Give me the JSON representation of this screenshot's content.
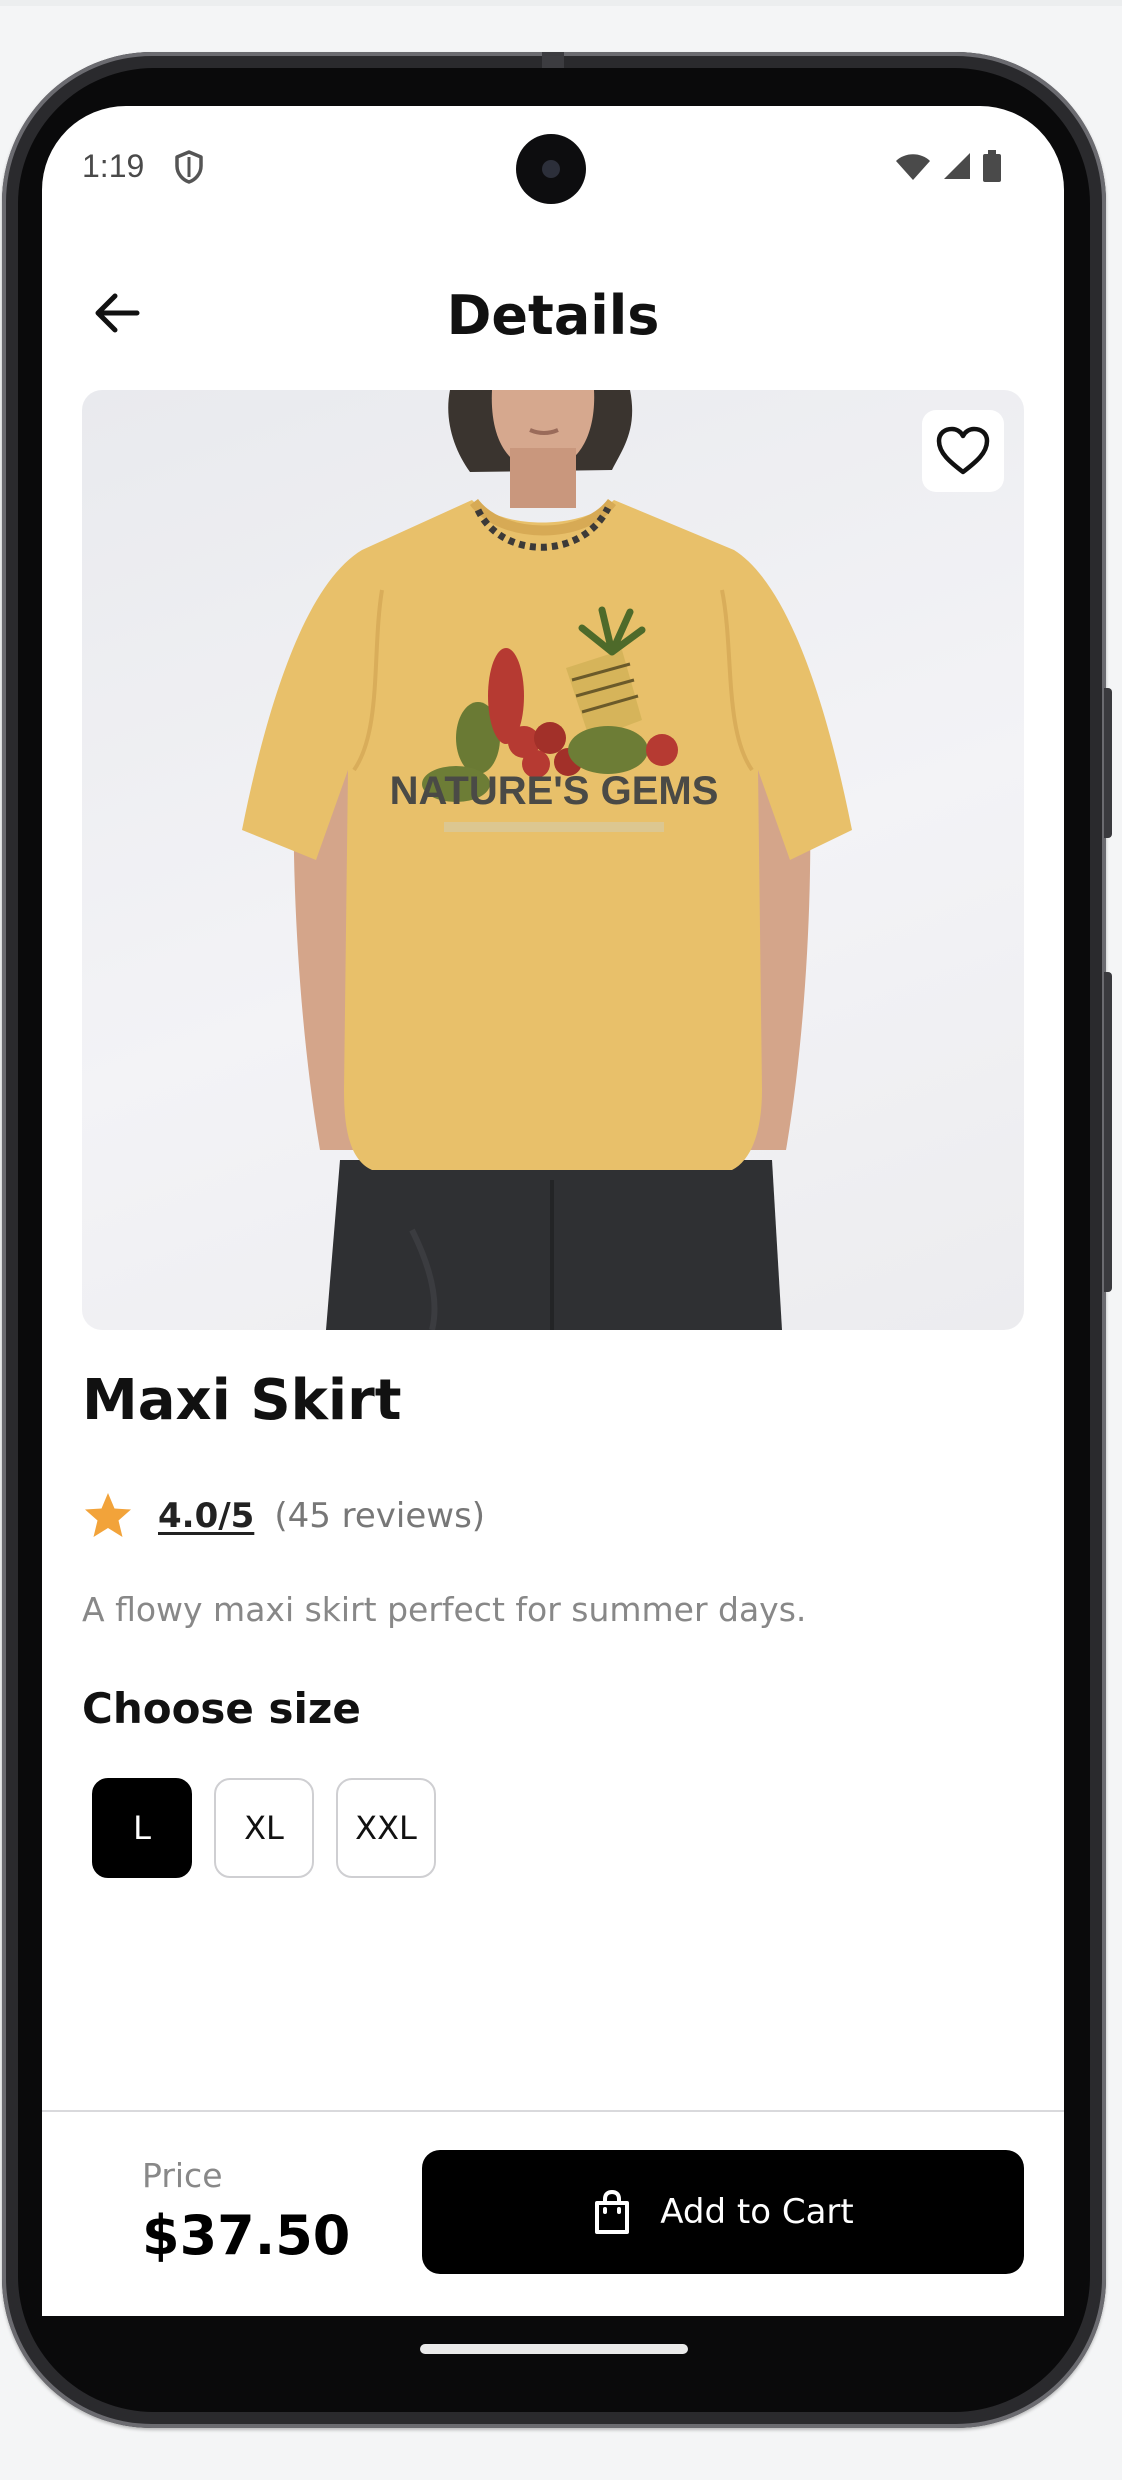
{
  "status_bar": {
    "time": "1:19",
    "left_icons": [
      "shield-icon"
    ],
    "right_icons": [
      "wifi-icon",
      "signal-icon",
      "battery-icon"
    ]
  },
  "header": {
    "title": "Details",
    "back_icon": "arrow-left-icon"
  },
  "product": {
    "image_description_icon": "tshirt-photo",
    "favorite_icon": "heart-outline-icon",
    "name": "Maxi Skirt",
    "rating": "4.0/5",
    "reviews": "(45 reviews)",
    "rating_star_color": "#F2A33A",
    "description": "A flowy maxi skirt perfect for summer days.",
    "image_print_text": "NATURE'S GEMS"
  },
  "size": {
    "heading": "Choose size",
    "options": [
      "L",
      "XL",
      "XXL"
    ],
    "selected": "L"
  },
  "footer": {
    "price_label": "Price",
    "price": "$37.50",
    "cart_button_label": "Add to Cart",
    "cart_icon": "shopping-bag-icon"
  },
  "colors": {
    "primary": "#000000",
    "background": "#FFFFFF",
    "muted_text": "#888888",
    "shirt": "#E8C06A"
  }
}
